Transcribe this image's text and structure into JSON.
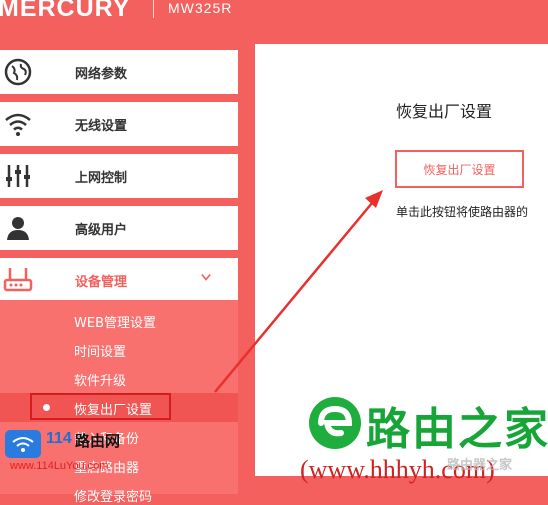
{
  "header": {
    "brand": "MERCURY",
    "model": "MW325R"
  },
  "sidebar": {
    "items": [
      {
        "label": "网络参数",
        "icon": "globe-icon"
      },
      {
        "label": "无线设置",
        "icon": "wifi-icon"
      },
      {
        "label": "上网控制",
        "icon": "sliders-icon"
      },
      {
        "label": "高级用户",
        "icon": "user-icon"
      },
      {
        "label": "设备管理",
        "icon": "router-icon",
        "expanded": true
      }
    ],
    "submenu": [
      {
        "label": "WEB管理设置"
      },
      {
        "label": "时间设置"
      },
      {
        "label": "软件升级"
      },
      {
        "label": "恢复出厂设置",
        "active": true
      },
      {
        "label": "载入和备份"
      },
      {
        "label": "重启路由器"
      },
      {
        "label": "修改登录密码"
      }
    ]
  },
  "content": {
    "title": "恢复出厂设置",
    "button_label": "恢复出厂设置",
    "description": "单击此按钮将使路由器的"
  },
  "watermarks": {
    "left_num": "114",
    "left_name": "路由网",
    "left_url": "www.114LuYou.com",
    "right_name": "路由之家",
    "right_url": "(www.hhhyh.com)",
    "faint": "路由器之家"
  },
  "colors": {
    "brand": "#f3605e",
    "annotation": "#d61d1d",
    "watermark_green": "#17a538"
  }
}
